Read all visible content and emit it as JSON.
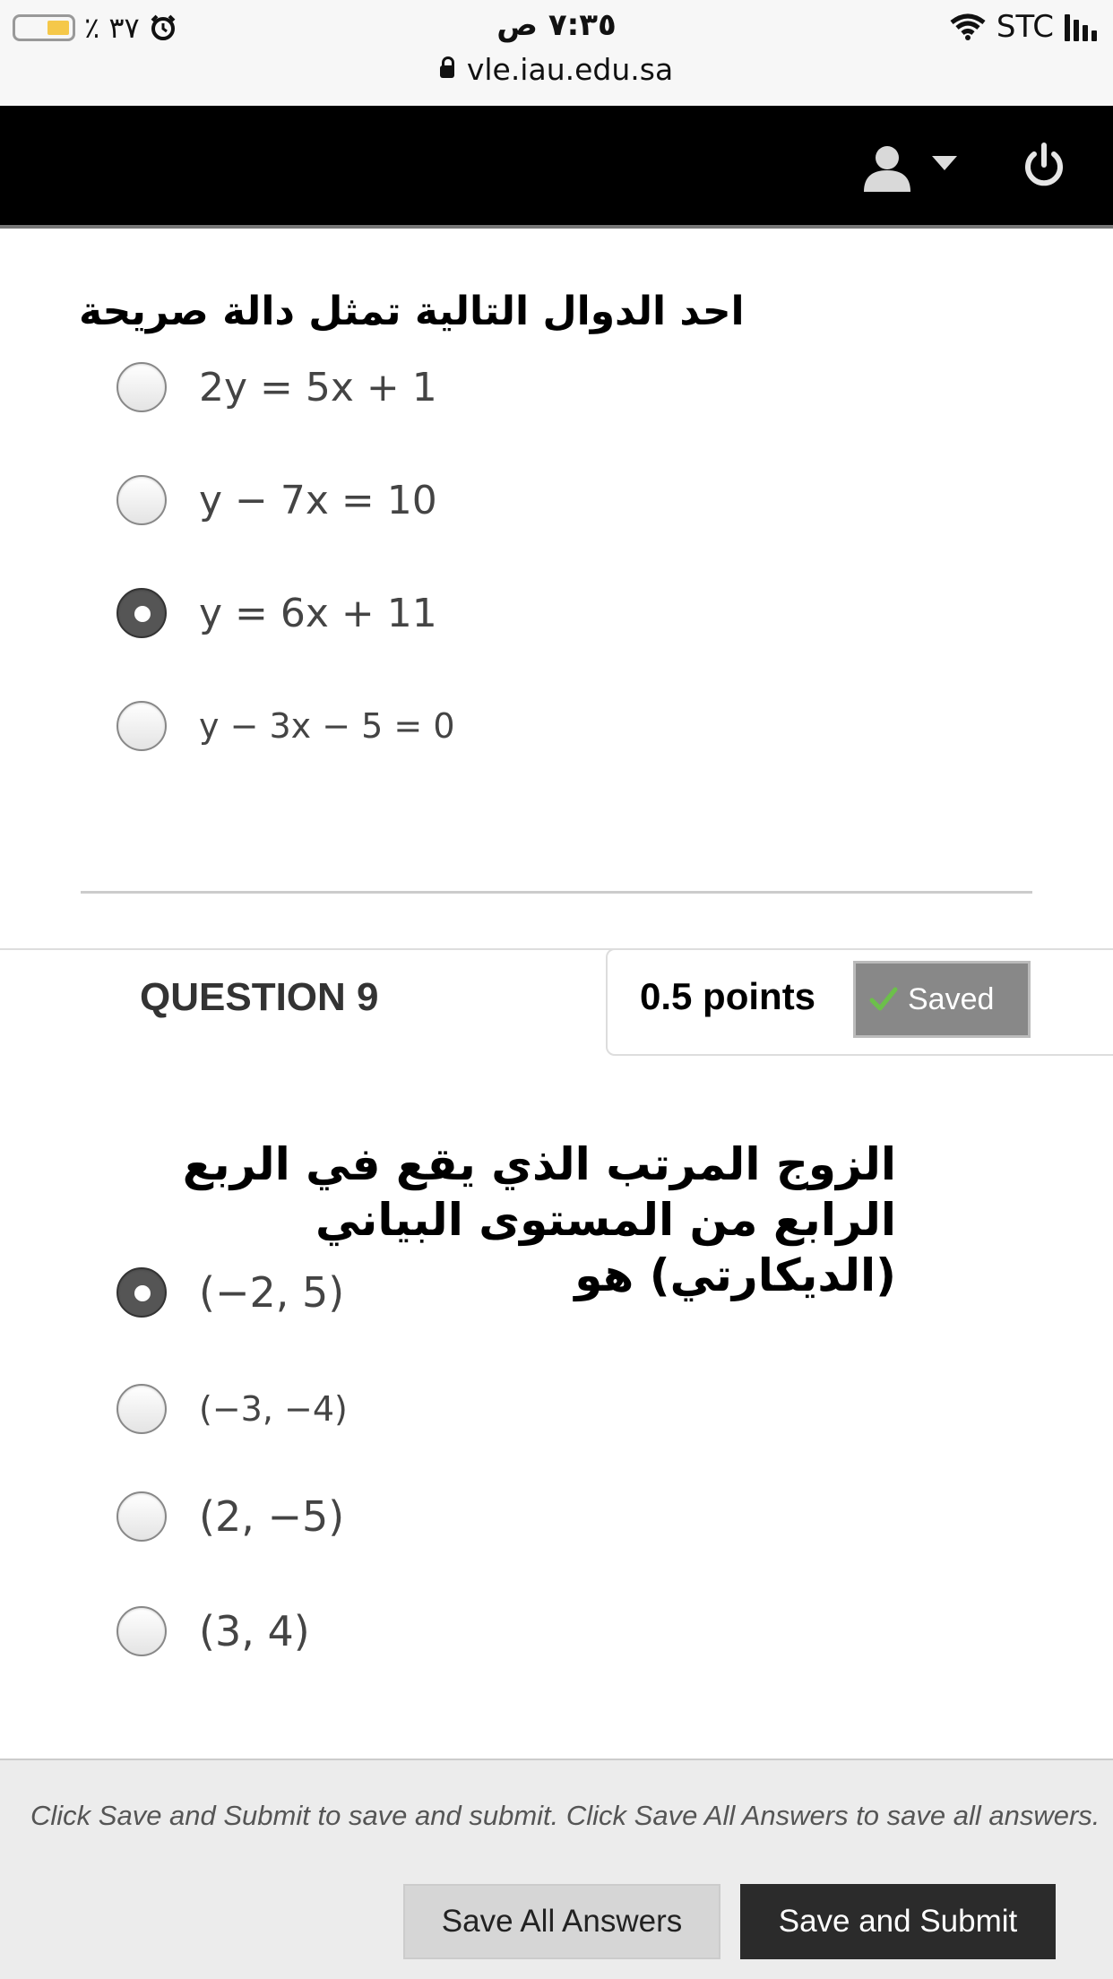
{
  "status_bar": {
    "battery_text": "٪ ٣٧",
    "time": "٧:٣٥ ص",
    "url": "vle.iau.edu.sa",
    "carrier": "STC"
  },
  "question8": {
    "text": "احد الدوال التالية تمثل دالة صريحة",
    "options": [
      {
        "label": "2y = 5x + 1",
        "selected": false
      },
      {
        "label": "y − 7x = 10",
        "selected": false
      },
      {
        "label": "y = 6x + 11",
        "selected": true
      },
      {
        "label": "y − 3x − 5 = 0",
        "selected": false
      }
    ]
  },
  "question9": {
    "title": "QUESTION 9",
    "points": "0.5 points",
    "saved_label": "Saved",
    "text": "الزوج المرتب الذي يقع في الربع الرابع من المستوى البياني (الديكارتي) هو",
    "options": [
      {
        "label": "(−2, 5)",
        "selected": true
      },
      {
        "label": "(−3, −4)",
        "selected": false
      },
      {
        "label": "(2, −5)",
        "selected": false
      },
      {
        "label": "(3, 4)",
        "selected": false
      }
    ]
  },
  "footer": {
    "hint": "Click Save and Submit to save and submit. Click Save All Answers to save all answers.",
    "save_all_label": "Save All Answers",
    "submit_label": "Save and Submit"
  },
  "colors": {
    "navbar": "#000000",
    "saved_badge": "#888888",
    "submit_button": "#2b2b2b",
    "check": "#5cb85c"
  }
}
